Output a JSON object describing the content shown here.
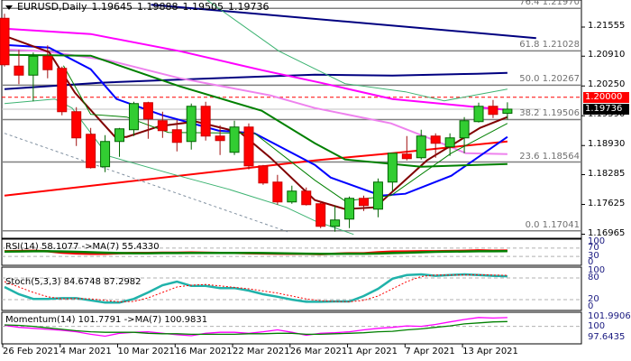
{
  "header": {
    "symbol": "EURUSD,Daily",
    "open": "1.19645",
    "high": "1.19888",
    "low": "1.19505",
    "close": "1.19736"
  },
  "colors": {
    "bull": "#32cd32",
    "bear": "#ff0000",
    "navy": "#000080",
    "magenta": "#ff00ff",
    "violet": "#ee82ee",
    "blue": "#0000ff",
    "maroon": "#800000",
    "darkgreen": "#008000",
    "seagreen": "#3cb371",
    "teal": "#20b2aa"
  },
  "chart_data": [
    {
      "type": "candlestick",
      "title": "EURUSD,Daily",
      "ylim": [
        1.169,
        1.2215
      ],
      "y_ticks": [
        "1.21555",
        "1.20910",
        "1.20250",
        "1.19590",
        "1.18930",
        "1.18285",
        "1.17625",
        "1.16965"
      ],
      "x_ticks": [
        {
          "index": 0,
          "label": "26 Feb 2021"
        },
        {
          "index": 4,
          "label": "4 Mar 2021"
        },
        {
          "index": 8,
          "label": "10 Mar 2021"
        },
        {
          "index": 12,
          "label": "16 Mar 2021"
        },
        {
          "index": 16,
          "label": "22 Mar 2021"
        },
        {
          "index": 20,
          "label": "26 Mar 2021"
        },
        {
          "index": 24,
          "label": "1 Apr 2021"
        },
        {
          "index": 28,
          "label": "7 Apr 2021"
        },
        {
          "index": 32,
          "label": "13 Apr 2021"
        }
      ],
      "ohlc": [
        [
          1.2175,
          1.2185,
          1.2068,
          1.2072
        ],
        [
          1.2069,
          1.2105,
          1.2029,
          1.2049
        ],
        [
          1.2049,
          1.2099,
          1.1991,
          1.2091
        ],
        [
          1.2091,
          1.2115,
          1.2042,
          1.2061
        ],
        [
          1.2064,
          1.2068,
          1.196,
          1.1968
        ],
        [
          1.1968,
          1.1978,
          1.1892,
          1.191
        ],
        [
          1.1918,
          1.1932,
          1.1842,
          1.1844
        ],
        [
          1.1846,
          1.1916,
          1.1834,
          1.1902
        ],
        [
          1.1902,
          1.1932,
          1.1868,
          1.193
        ],
        [
          1.1928,
          1.199,
          1.1914,
          1.1986
        ],
        [
          1.1988,
          1.199,
          1.1908,
          1.1952
        ],
        [
          1.1948,
          1.1968,
          1.191,
          1.1926
        ],
        [
          1.1928,
          1.195,
          1.188,
          1.19
        ],
        [
          1.1902,
          1.1986,
          1.1884,
          1.198
        ],
        [
          1.198,
          1.199,
          1.1904,
          1.1914
        ],
        [
          1.1914,
          1.1938,
          1.1872,
          1.1904
        ],
        [
          1.1878,
          1.1948,
          1.1872,
          1.1934
        ],
        [
          1.1934,
          1.1942,
          1.184,
          1.1848
        ],
        [
          1.1848,
          1.185,
          1.1806,
          1.181
        ],
        [
          1.1812,
          1.1828,
          1.1762,
          1.1768
        ],
        [
          1.1768,
          1.1804,
          1.1764,
          1.1792
        ],
        [
          1.1792,
          1.18,
          1.176,
          1.1762
        ],
        [
          1.1764,
          1.177,
          1.171,
          1.1714
        ],
        [
          1.1714,
          1.176,
          1.1702,
          1.1728
        ],
        [
          1.173,
          1.178,
          1.171,
          1.1776
        ],
        [
          1.1776,
          1.1782,
          1.1748,
          1.176
        ],
        [
          1.1752,
          1.182,
          1.1734,
          1.1812
        ],
        [
          1.1812,
          1.1876,
          1.1792,
          1.1876
        ],
        [
          1.1874,
          1.1914,
          1.186,
          1.1864
        ],
        [
          1.1866,
          1.1928,
          1.1862,
          1.1914
        ],
        [
          1.1914,
          1.192,
          1.1866,
          1.1898
        ],
        [
          1.189,
          1.192,
          1.187,
          1.191
        ],
        [
          1.191,
          1.1956,
          1.1876,
          1.1948
        ],
        [
          1.1946,
          1.1988,
          1.1944,
          1.198
        ],
        [
          1.198,
          1.1994,
          1.1954,
          1.1962
        ],
        [
          1.19645,
          1.19888,
          1.19505,
          1.19736
        ]
      ],
      "lines": [
        {
          "name": "navy-trendline",
          "color": "navy",
          "width": 2,
          "points": [
            [
              10.2,
              1.2205
            ],
            [
              37,
              1.2131
            ]
          ]
        },
        {
          "name": "navy-ma",
          "color": "navy",
          "width": 2,
          "points": [
            [
              0,
              1.2018
            ],
            [
              6.6,
              1.2032
            ],
            [
              12.9,
              1.204
            ],
            [
              21.6,
              1.205
            ],
            [
              27,
              1.2048
            ],
            [
              32.9,
              1.2052
            ],
            [
              35,
              1.2054
            ]
          ]
        },
        {
          "name": "magenta-ma",
          "color": "magenta",
          "width": 2,
          "points": [
            [
              0,
              1.2152
            ],
            [
              6,
              1.214
            ],
            [
              12.2,
              1.2102
            ],
            [
              17.9,
              1.206
            ],
            [
              22,
              1.2032
            ],
            [
              27,
              1.1996
            ],
            [
              32.9,
              1.1978
            ],
            [
              35,
              1.1972
            ]
          ]
        },
        {
          "name": "violet-ma",
          "color": "violet",
          "width": 2,
          "points": [
            [
              0,
              1.2106
            ],
            [
              2.8,
              1.2102
            ],
            [
              7.2,
              1.2082
            ],
            [
              12.2,
              1.2042
            ],
            [
              18.5,
              1.2004
            ],
            [
              21.6,
              1.1976
            ],
            [
              26.9,
              1.1942
            ],
            [
              29.8,
              1.1906
            ],
            [
              32.1,
              1.1876
            ],
            [
              35,
              1.1874
            ]
          ]
        },
        {
          "name": "red-ma",
          "color": "bear",
          "width": 2,
          "points": [
            [
              0,
              1.1782
            ],
            [
              21.6,
              1.186
            ],
            [
              27,
              1.1876
            ],
            [
              35,
              1.1902
            ]
          ]
        },
        {
          "name": "blue-ma",
          "color": "blue",
          "width": 2,
          "points": [
            [
              0,
              1.2116
            ],
            [
              3.1,
              1.211
            ],
            [
              6,
              1.2062
            ],
            [
              7.8,
              1.1996
            ],
            [
              11,
              1.196
            ],
            [
              14.9,
              1.1926
            ],
            [
              17.4,
              1.192
            ],
            [
              21.6,
              1.185
            ],
            [
              22.7,
              1.1822
            ],
            [
              26.2,
              1.1782
            ],
            [
              27.9,
              1.1786
            ],
            [
              31.1,
              1.1826
            ],
            [
              35,
              1.1912
            ]
          ]
        },
        {
          "name": "maroon-ma",
          "color": "maroon",
          "width": 2,
          "points": [
            [
              0,
              1.2136
            ],
            [
              3.1,
              1.21
            ],
            [
              4.9,
              1.201
            ],
            [
              7.7,
              1.1912
            ],
            [
              8.5,
              1.1912
            ],
            [
              10.8,
              1.1936
            ],
            [
              13.3,
              1.1946
            ],
            [
              16.4,
              1.1922
            ],
            [
              18.5,
              1.1866
            ],
            [
              21.6,
              1.1772
            ],
            [
              23.7,
              1.1752
            ],
            [
              25.8,
              1.1756
            ],
            [
              29.4,
              1.186
            ],
            [
              33.1,
              1.1932
            ],
            [
              35,
              1.1956
            ]
          ]
        },
        {
          "name": "darkgreen-ma",
          "color": "darkgreen",
          "width": 2,
          "points": [
            [
              0,
              1.2094
            ],
            [
              6,
              1.2092
            ],
            [
              12.2,
              1.2024
            ],
            [
              17.9,
              1.197
            ],
            [
              21.6,
              1.1898
            ],
            [
              23.7,
              1.1862
            ],
            [
              29,
              1.1846
            ],
            [
              35,
              1.1852
            ]
          ]
        },
        {
          "name": "upper-band",
          "color": "seagreen",
          "width": 1,
          "points": [
            [
              14.1,
              1.2215
            ],
            [
              19.1,
              1.2102
            ],
            [
              23.7,
              1.203
            ],
            [
              27.9,
              1.2012
            ],
            [
              30.6,
              1.1992
            ],
            [
              35,
              1.2018
            ]
          ]
        },
        {
          "name": "lower-band",
          "color": "seagreen",
          "width": 1,
          "points": [
            [
              0,
              1.1986
            ],
            [
              3.5,
              1.1996
            ],
            [
              4.7,
              1.1976
            ],
            [
              7.2,
              1.187
            ],
            [
              11.4,
              1.1832
            ],
            [
              15.6,
              1.1796
            ],
            [
              19.6,
              1.1756
            ],
            [
              21.6,
              1.1726
            ],
            [
              24.3,
              1.1696
            ]
          ]
        },
        {
          "name": "thin-green-ma",
          "color": "darkgreen",
          "width": 1,
          "points": [
            [
              4.1,
              1.207
            ],
            [
              6,
              1.1962
            ],
            [
              8.5,
              1.1956
            ],
            [
              11.4,
              1.1922
            ],
            [
              17.4,
              1.192
            ],
            [
              21.6,
              1.1816
            ],
            [
              23.7,
              1.177
            ],
            [
              26.9,
              1.1782
            ],
            [
              31.1,
              1.1876
            ],
            [
              35,
              1.1942
            ]
          ]
        },
        {
          "name": "grey-dashed-trendline",
          "color": "grey",
          "width": 1,
          "dashed": true,
          "points": [
            [
              0,
              1.192
            ],
            [
              19.7,
              1.1702
            ]
          ]
        }
      ],
      "fibonacci": [
        {
          "level": "76.4",
          "price": "1.21970",
          "value": 1.2197
        },
        {
          "level": "61.8",
          "price": "1.21028",
          "value": 1.21028
        },
        {
          "level": "50.0",
          "price": "1.20267",
          "value": 1.20267
        },
        {
          "level": "38.2",
          "price": "1.19506",
          "value": 1.19506
        },
        {
          "level": "23.6",
          "price": "1.18564",
          "value": 1.18564
        },
        {
          "level": "0.0",
          "price": "1.17041",
          "value": 1.17041
        }
      ],
      "alert_level": {
        "label": "1.20000",
        "value": 1.2
      },
      "bid": {
        "label": "1.19736",
        "value": 1.19736
      }
    },
    {
      "type": "line",
      "title": "RSI(14) 58.1077  ->MA(7) 55.4330",
      "ylim": [
        0,
        100
      ],
      "y_ticks": [
        "100",
        "70",
        "30",
        "0"
      ],
      "levels": [
        70,
        30
      ],
      "series": [
        {
          "name": "RSI(14)",
          "color": "bear",
          "values": [
            55,
            56,
            57,
            55,
            48,
            44,
            42,
            42,
            45,
            47,
            47,
            48,
            48,
            49,
            48,
            47,
            47,
            45,
            44,
            43,
            42,
            42,
            41,
            43,
            45,
            45,
            50,
            53,
            54,
            55,
            55,
            56,
            57,
            59,
            58,
            58.1
          ]
        },
        {
          "name": "MA(7)",
          "color": "darkgreen",
          "values": [
            53,
            54,
            55,
            55,
            54,
            52,
            50,
            48,
            46,
            45,
            45,
            46,
            46,
            47,
            47,
            47,
            47,
            47,
            46,
            45,
            44,
            43,
            42,
            42,
            43,
            43,
            44,
            46,
            48,
            50,
            52,
            53,
            54,
            55,
            55,
            55.4
          ]
        }
      ]
    },
    {
      "type": "line",
      "title": "Stoch(5,3,3) 84.6748 87.2982",
      "ylim": [
        0,
        100
      ],
      "y_ticks": [
        "100",
        "80",
        "20",
        "0"
      ],
      "levels": [
        80,
        20
      ],
      "series": [
        {
          "name": "%K",
          "color": "teal",
          "values": [
            55,
            35,
            22,
            22,
            24,
            24,
            18,
            12,
            12,
            22,
            40,
            60,
            70,
            58,
            58,
            52,
            52,
            45,
            35,
            28,
            20,
            14,
            14,
            15,
            15,
            30,
            50,
            78,
            88,
            90,
            86,
            88,
            90,
            88,
            86,
            84.7
          ]
        },
        {
          "name": "%D",
          "color": "bear",
          "dashed": true,
          "values": [
            70,
            55,
            40,
            28,
            22,
            23,
            22,
            18,
            14,
            15,
            25,
            40,
            55,
            60,
            62,
            58,
            54,
            50,
            44,
            38,
            30,
            22,
            17,
            15,
            14,
            18,
            30,
            50,
            70,
            84,
            88,
            88,
            88,
            89,
            88,
            87.3
          ]
        }
      ]
    },
    {
      "type": "line",
      "title": "Momentum(14) 101.7791  ->MA(7) 100.9831",
      "ylim": [
        97.0,
        102.5
      ],
      "y_ticks": [
        "101.9906",
        "100",
        "97.6435"
      ],
      "levels": [
        100
      ],
      "series": [
        {
          "name": "Momentum(14)",
          "color": "magenta",
          "values": [
            100.2,
            99.8,
            99.6,
            99.4,
            99.2,
            98.9,
            98.4,
            98.0,
            98.6,
            98.8,
            98.9,
            98.6,
            98.3,
            98.1,
            98.6,
            98.8,
            98.8,
            98.6,
            98.9,
            99.3,
            98.8,
            98.2,
            98.6,
            98.7,
            98.9,
            99.3,
            99.6,
            99.8,
            100.1,
            100.0,
            100.4,
            100.9,
            101.4,
            101.8,
            101.7,
            101.78
          ]
        },
        {
          "name": "MA(7)",
          "color": "darkgreen",
          "values": [
            100.3,
            100.2,
            100.0,
            99.7,
            99.4,
            99.1,
            98.9,
            98.8,
            98.8,
            98.8,
            98.6,
            98.5,
            98.5,
            98.4,
            98.4,
            98.4,
            98.4,
            98.5,
            98.5,
            98.6,
            98.6,
            98.4,
            98.4,
            98.5,
            98.6,
            98.7,
            98.9,
            99.0,
            99.3,
            99.5,
            99.8,
            100.1,
            100.5,
            100.7,
            100.9,
            100.98
          ]
        }
      ]
    }
  ]
}
